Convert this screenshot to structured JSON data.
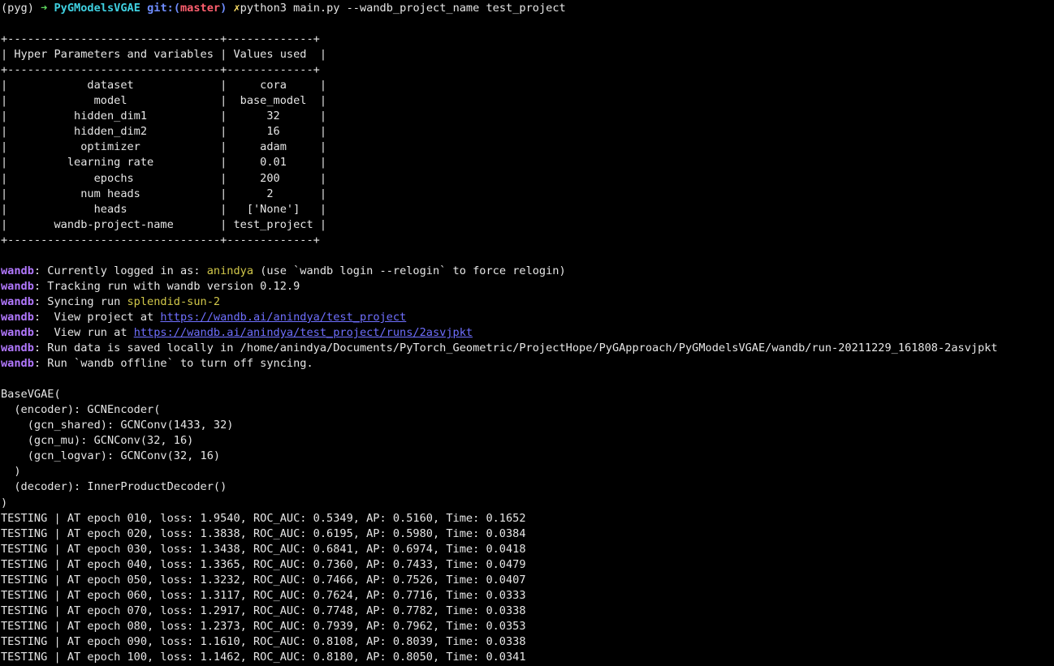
{
  "prompt": {
    "env": "(pyg)",
    "arrow": "➜",
    "dir": "PyGModelsVGAE",
    "git_label": "git:(",
    "branch": "master",
    "git_close": ")",
    "dirty": "✗",
    "command": "python3 main.py --wandb_project_name test_project"
  },
  "param_table": {
    "border": "+--------------------------------+-------------+",
    "header": "| Hyper Parameters and variables | Values used  |",
    "rows": [
      "|            dataset             |     cora     |",
      "|             model              |  base_model  |",
      "|          hidden_dim1           |      32      |",
      "|          hidden_dim2           |      16      |",
      "|           optimizer            |     adam     |",
      "|         learning rate          |     0.01     |",
      "|             epochs             |     200      |",
      "|           num heads            |      2       |",
      "|             heads              |   ['None']   |",
      "|       wandb-project-name       | test_project |"
    ]
  },
  "wandb": {
    "tag": "wandb",
    "l1_a": ": Currently logged in as: ",
    "l1_user": "anindya",
    "l1_b": " (use `wandb login --relogin` to force relogin)",
    "l2": ": Tracking run with wandb version 0.12.9",
    "l3_a": ": Syncing run ",
    "l3_run": "splendid-sun-2",
    "l4_a": ":  View project at ",
    "l4_link": "https://wandb.ai/anindya/test_project",
    "l5_a": ":  View run at ",
    "l5_link": "https://wandb.ai/anindya/test_project/runs/2asvjpkt",
    "l6": ": Run data is saved locally in /home/anindya/Documents/PyTorch_Geometric/ProjectHope/PyGApproach/PyGModelsVGAE/wandb/run-20211229_161808-2asvjpkt",
    "l7": ": Run `wandb offline` to turn off syncing."
  },
  "model_print": [
    "BaseVGAE(",
    "  (encoder): GCNEncoder(",
    "    (gcn_shared): GCNConv(1433, 32)",
    "    (gcn_mu): GCNConv(32, 16)",
    "    (gcn_logvar): GCNConv(32, 16)",
    "  )",
    "  (decoder): InnerProductDecoder()",
    ")"
  ],
  "testing": [
    "TESTING | AT epoch 010, loss: 1.9540, ROC_AUC: 0.5349, AP: 0.5160, Time: 0.1652",
    "TESTING | AT epoch 020, loss: 1.3838, ROC_AUC: 0.6195, AP: 0.5980, Time: 0.0384",
    "TESTING | AT epoch 030, loss: 1.3438, ROC_AUC: 0.6841, AP: 0.6974, Time: 0.0418",
    "TESTING | AT epoch 040, loss: 1.3365, ROC_AUC: 0.7360, AP: 0.7433, Time: 0.0479",
    "TESTING | AT epoch 050, loss: 1.3232, ROC_AUC: 0.7466, AP: 0.7526, Time: 0.0407",
    "TESTING | AT epoch 060, loss: 1.3117, ROC_AUC: 0.7624, AP: 0.7716, Time: 0.0333",
    "TESTING | AT epoch 070, loss: 1.2917, ROC_AUC: 0.7748, AP: 0.7782, Time: 0.0338",
    "TESTING | AT epoch 080, loss: 1.2373, ROC_AUC: 0.7939, AP: 0.7962, Time: 0.0353",
    "TESTING | AT epoch 090, loss: 1.1610, ROC_AUC: 0.8108, AP: 0.8039, Time: 0.0338",
    "TESTING | AT epoch 100, loss: 1.1462, ROC_AUC: 0.8180, AP: 0.8050, Time: 0.0341"
  ],
  "colors": {
    "background": "#000000",
    "text": "#e6e6e6",
    "prompt_arrow": "#5fd85f",
    "dir": "#3fd0e0",
    "git": "#6f8dff",
    "branch": "#ff5f6f",
    "dirty": "#ffe066",
    "wandb_tag": "#b278ff",
    "highlight": "#d2c84a",
    "link": "#6f6fff"
  }
}
